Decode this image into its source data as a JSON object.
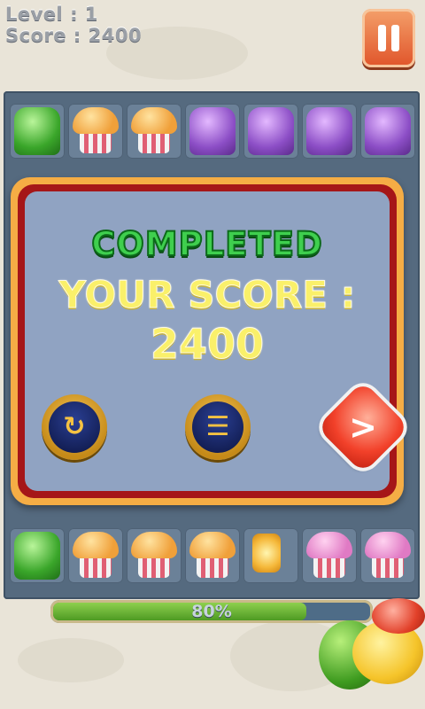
{
  "hud": {
    "level_text": "Level : 1",
    "score_text": "Score : 2400"
  },
  "pause_button": {
    "icon": "pause-icon"
  },
  "board": {
    "visible_top_row": [
      "green-jelly",
      "orange-cupcake",
      "orange-cupcake",
      "purple-jelly",
      "purple-jelly",
      "purple-jelly",
      "purple-jelly"
    ],
    "visible_bottom_row": [
      "green-jelly",
      "orange-cupcake",
      "orange-cupcake",
      "orange-cupcake",
      "lightning-bonus",
      "pink-cupcake",
      "pink-cupcake"
    ]
  },
  "dialog": {
    "title": "COMPLETED",
    "score_label": "YOUR SCORE :",
    "score_value": "2400",
    "buttons": {
      "replay": {
        "icon": "replay-icon",
        "glyph": "↻"
      },
      "menu": {
        "icon": "level-menu-icon",
        "glyph": "☰"
      },
      "next": {
        "icon": "next-arrow-icon",
        "glyph": ">"
      }
    }
  },
  "progress": {
    "percent": 80,
    "label": "80%"
  },
  "colors": {
    "title_green": "#3fcf4e",
    "score_yellow": "#faf06a",
    "dialog_border_orange": "#f5ad45",
    "dialog_border_red": "#a51618",
    "panel_blue": "#90a3c2",
    "progress_green": "#6fb83a"
  }
}
